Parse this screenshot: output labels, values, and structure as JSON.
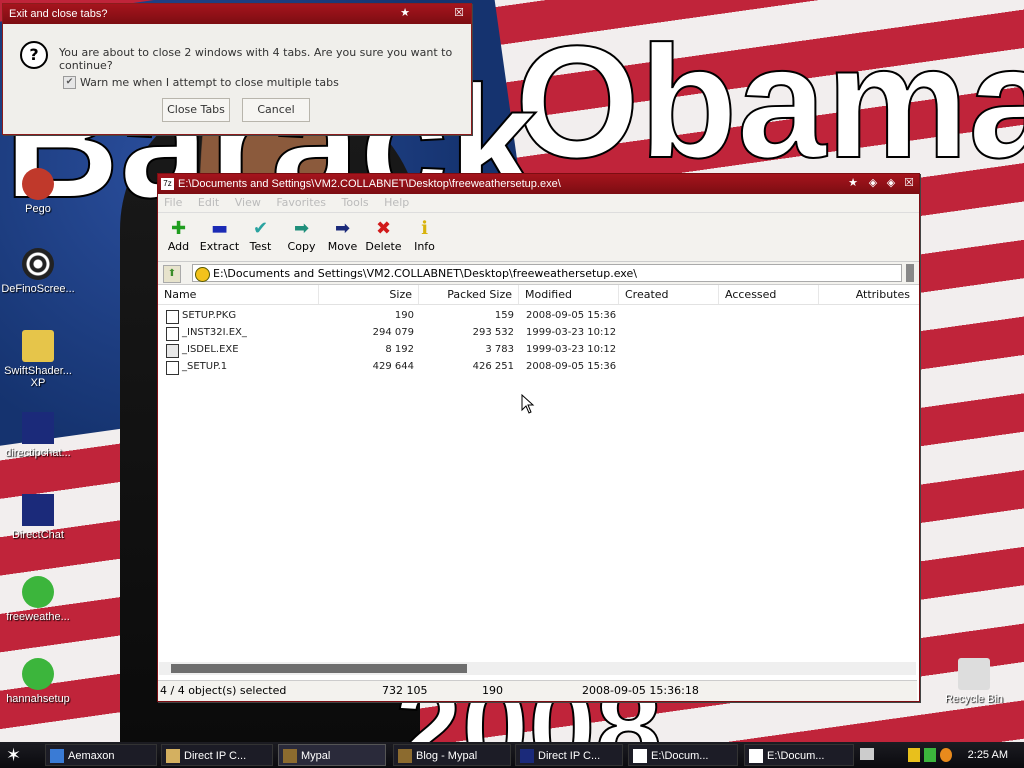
{
  "desktop": {
    "background_texts": {
      "obama": "Obama",
      "left": "Barack",
      "year": "2008"
    },
    "icons": [
      {
        "label": "Pego",
        "color": "#c0392b"
      },
      {
        "label": "DeFinoScree...",
        "color": "#333333"
      },
      {
        "label": "SwiftShader...\nXP",
        "color": "#e6c54a"
      },
      {
        "label": "directipchat...",
        "color": "#1b2a7a"
      },
      {
        "label": "DirectChat",
        "color": "#1b2a7a"
      },
      {
        "label": "freeweathe...",
        "color": "#3cb53c"
      },
      {
        "label": "hannahsetup",
        "color": "#3cb53c"
      },
      {
        "label": "Recycle Bin",
        "color": "#dddddd"
      }
    ]
  },
  "dialog": {
    "title": "Exit and close tabs?",
    "message": "You are about to close 2 windows with 4 tabs. Are you sure you want to continue?",
    "checkbox_label": "Warn me when I attempt to close multiple tabs",
    "checked_mark": "✔",
    "close_tabs_label": "Close Tabs",
    "cancel_label": "Cancel"
  },
  "window": {
    "title": "E:\\Documents and Settings\\VM2.COLLABNET\\Desktop\\freeweathersetup.exe\\",
    "menu": [
      "File",
      "Edit",
      "View",
      "Favorites",
      "Tools",
      "Help"
    ],
    "toolbar": [
      {
        "label": "Add",
        "icon": "plus-icon",
        "glyph": "✚",
        "color": "#1f9d1f"
      },
      {
        "label": "Extract",
        "icon": "minus-icon",
        "glyph": "▬",
        "color": "#1b2bb5"
      },
      {
        "label": "Test",
        "icon": "check-icon",
        "glyph": "✔",
        "color": "#2aa3a0"
      },
      {
        "label": "Copy",
        "icon": "copy-arrow-icon",
        "glyph": "➡",
        "color": "#1f8f7a"
      },
      {
        "label": "Move",
        "icon": "move-arrow-icon",
        "glyph": "➡",
        "color": "#1b2a7a"
      },
      {
        "label": "Delete",
        "icon": "delete-icon",
        "glyph": "✖",
        "color": "#d11a1a"
      },
      {
        "label": "Info",
        "icon": "info-icon",
        "glyph": "ℹ",
        "color": "#d8b30c"
      }
    ],
    "address": "E:\\Documents and Settings\\VM2.COLLABNET\\Desktop\\freeweathersetup.exe\\",
    "columns": [
      "Name",
      "Size",
      "Packed Size",
      "Modified",
      "Created",
      "Accessed",
      "Attributes"
    ],
    "rows": [
      {
        "name": "SETUP.PKG",
        "size": "190",
        "packed": "159",
        "modified": "2008-09-05 15:36"
      },
      {
        "name": "_INST32I.EX_",
        "size": "294 079",
        "packed": "293 532",
        "modified": "1999-03-23 10:12"
      },
      {
        "name": "_ISDEL.EXE",
        "size": "8 192",
        "packed": "3 783",
        "modified": "1999-03-23 10:12"
      },
      {
        "name": "_SETUP.1",
        "size": "429 644",
        "packed": "426 251",
        "modified": "2008-09-05 15:36"
      }
    ],
    "status": {
      "selected": "4 / 4 object(s) selected",
      "total_size": "732 105",
      "packed": "190",
      "modified": "2008-09-05 15:36:18"
    }
  },
  "taskbar": {
    "items": [
      {
        "label": "Aemaxon"
      },
      {
        "label": "Direct IP C..."
      },
      {
        "label": "Mypal"
      },
      {
        "label": "Blog - Mypal"
      },
      {
        "label": "Direct IP C..."
      },
      {
        "label": "E:\\Docum..."
      },
      {
        "label": "E:\\Docum..."
      }
    ],
    "clock": "2:25 AM"
  }
}
